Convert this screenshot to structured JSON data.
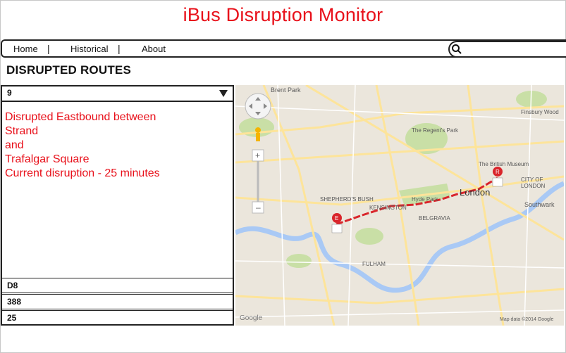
{
  "app": {
    "title": "iBus Disruption Monitor"
  },
  "nav": {
    "items": [
      "Home",
      "Historical",
      "About"
    ],
    "separator": "|"
  },
  "search": {
    "placeholder": ""
  },
  "section": {
    "title": "DISRUPTED ROUTES"
  },
  "selected_route": {
    "value": "9",
    "lines": [
      "Disrupted Eastbound between",
      "Strand",
      "and",
      "Trafalgar Square",
      "",
      "Current disruption - 25 minutes"
    ]
  },
  "route_list": [
    "D8",
    "388",
    "25"
  ],
  "map": {
    "labels": {
      "brent_park": "Brent Park",
      "regents_park": "The Regent's Park",
      "hyde_park": "Hyde Park",
      "london": "London",
      "shepherds_bush": "SHEPHERD'S BUSH",
      "kensington": "KENSINGTON",
      "belgravia": "BELGRAVIA",
      "fulham": "FULHAM",
      "southwark": "Southwark",
      "city_of_london": "CITY OF LONDON",
      "british_museum": "The British Museum",
      "finsbury": "Finsbury Wood",
      "copyright": "Map data ©2014 Google",
      "google": "Google"
    },
    "markers": {
      "start": "E",
      "end": "R"
    },
    "colors": {
      "route": "#d9252b",
      "water": "#a9c9f5",
      "park": "#c9dfa6",
      "road": "#fde49a"
    }
  }
}
